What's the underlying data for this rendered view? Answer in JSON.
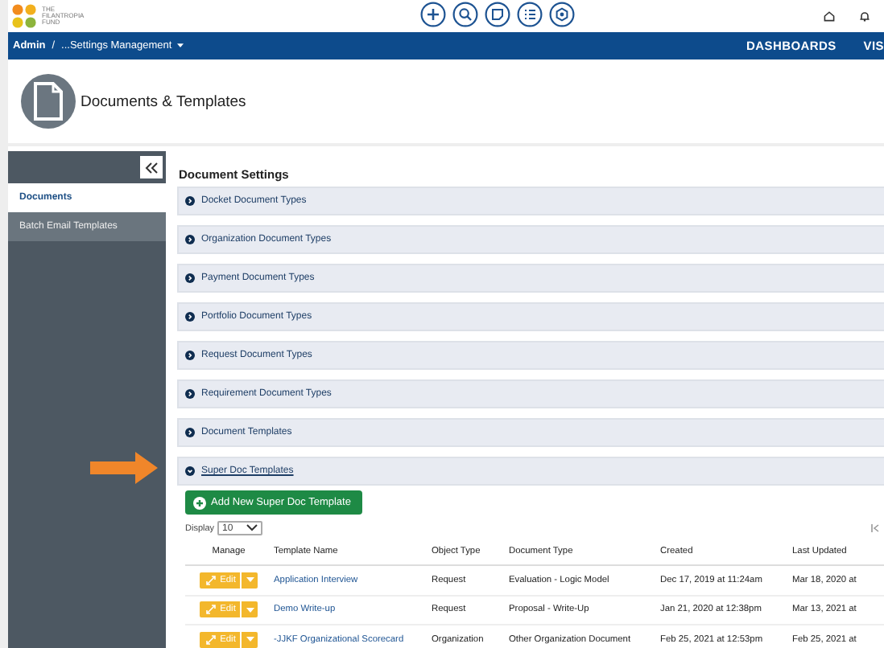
{
  "logo": {
    "lines": [
      "THE",
      "FILANTROPIA",
      "FUND"
    ]
  },
  "nav": {
    "root": "Admin",
    "separator": "/",
    "current": "...Settings Management",
    "links": [
      "DASHBOARDS",
      "VIS"
    ]
  },
  "page": {
    "title": "Documents & Templates"
  },
  "sidebar": {
    "items": [
      {
        "label": "Documents",
        "selected": true
      },
      {
        "label": "Batch Email Templates",
        "selected": false
      }
    ]
  },
  "section": {
    "title": "Document Settings",
    "panels": [
      {
        "label": "Docket Document Types",
        "expanded": false
      },
      {
        "label": "Organization Document Types",
        "expanded": false
      },
      {
        "label": "Payment Document Types",
        "expanded": false
      },
      {
        "label": "Portfolio Document Types",
        "expanded": false
      },
      {
        "label": "Request Document Types",
        "expanded": false
      },
      {
        "label": "Requirement Document Types",
        "expanded": false
      },
      {
        "label": "Document Templates",
        "expanded": false
      },
      {
        "label": "Super Doc Templates",
        "expanded": true
      }
    ]
  },
  "super_doc": {
    "add_button": "Add New Super Doc Template",
    "display_label": "Display",
    "display_value": "10",
    "columns": [
      "Manage",
      "Template Name",
      "Object Type",
      "Document Type",
      "Created",
      "Last Updated"
    ],
    "rows": [
      {
        "action": "Edit",
        "name": "Application Interview",
        "object_type": "Request",
        "document_type": "Evaluation - Logic Model",
        "created": "Dec 17, 2019 at 11:24am",
        "last_updated": "Mar 18, 2020 at"
      },
      {
        "action": "Edit",
        "name": "Demo Write-up",
        "object_type": "Request",
        "document_type": "Proposal - Write-Up",
        "created": "Jan 21, 2020 at 12:38pm",
        "last_updated": "Mar 13, 2021 at"
      },
      {
        "action": "Edit",
        "name": "-JJKF Organizational Scorecard",
        "object_type": "Organization",
        "document_type": "Other Organization Document",
        "created": "Feb 25, 2021 at 12:53pm",
        "last_updated": "Feb 25, 2021 at"
      }
    ]
  }
}
